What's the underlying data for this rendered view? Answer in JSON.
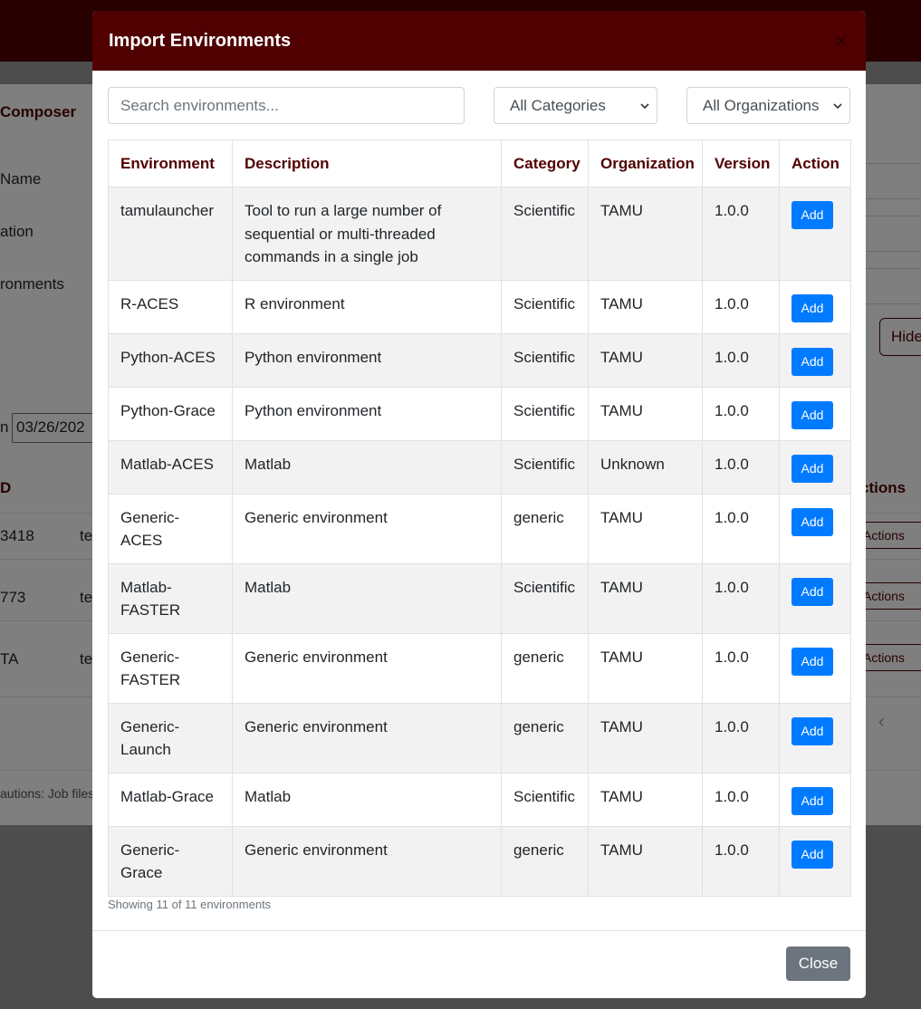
{
  "background": {
    "title": "Composer",
    "labels": [
      "Name",
      "ation",
      "ronments"
    ],
    "date_value": "03/26/202",
    "date_label": "n",
    "table_header_left": "D",
    "table_header_right": "ctions",
    "rows": [
      {
        "id": "3418",
        "name": "te",
        "actions": "Actions"
      },
      {
        "id": "773",
        "name": "te",
        "actions": "Actions"
      },
      {
        "id": "TA",
        "name": "te",
        "actions": "Actions"
      }
    ],
    "hide_button": "Hide",
    "footnote": "autions: Job files",
    "chevron": "‹"
  },
  "modal": {
    "title": "Import Environments",
    "close_x": "×",
    "search": {
      "placeholder": "Search environments...",
      "value": ""
    },
    "category_filter": {
      "selected": "All Categories"
    },
    "organization_filter": {
      "selected": "All Organizations"
    },
    "columns": [
      "Environment",
      "Description",
      "Category",
      "Organization",
      "Version",
      "Action"
    ],
    "rows": [
      {
        "environment": "tamulauncher",
        "description": "Tool to run a large number of sequential or multi-threaded commands in a single job",
        "category": "Scientific",
        "organization": "TAMU",
        "version": "1.0.0",
        "action": "Add"
      },
      {
        "environment": "R-ACES",
        "description": "R environment",
        "category": "Scientific",
        "organization": "TAMU",
        "version": "1.0.0",
        "action": "Add"
      },
      {
        "environment": "Python-ACES",
        "description": "Python environment",
        "category": "Scientific",
        "organization": "TAMU",
        "version": "1.0.0",
        "action": "Add"
      },
      {
        "environment": "Python-Grace",
        "description": "Python environment",
        "category": "Scientific",
        "organization": "TAMU",
        "version": "1.0.0",
        "action": "Add"
      },
      {
        "environment": "Matlab-ACES",
        "description": "Matlab",
        "category": "Scientific",
        "organization": "Unknown",
        "version": "1.0.0",
        "action": "Add"
      },
      {
        "environment": "Generic-ACES",
        "description": "Generic environment",
        "category": "generic",
        "organization": "TAMU",
        "version": "1.0.0",
        "action": "Add"
      },
      {
        "environment": "Matlab-FASTER",
        "description": "Matlab",
        "category": "Scientific",
        "organization": "TAMU",
        "version": "1.0.0",
        "action": "Add"
      },
      {
        "environment": "Generic-FASTER",
        "description": "Generic environment",
        "category": "generic",
        "organization": "TAMU",
        "version": "1.0.0",
        "action": "Add"
      },
      {
        "environment": "Generic-Launch",
        "description": "Generic environment",
        "category": "generic",
        "organization": "TAMU",
        "version": "1.0.0",
        "action": "Add"
      },
      {
        "environment": "Matlab-Grace",
        "description": "Matlab",
        "category": "Scientific",
        "organization": "TAMU",
        "version": "1.0.0",
        "action": "Add"
      },
      {
        "environment": "Generic-Grace",
        "description": "Generic environment",
        "category": "generic",
        "organization": "TAMU",
        "version": "1.0.0",
        "action": "Add"
      }
    ],
    "showing_text": "Showing 11 of 11 environments",
    "close_button": "Close"
  },
  "colors": {
    "brand": "#500000",
    "primary_button": "#007bff",
    "secondary_button": "#6c757d"
  },
  "icons": {
    "modal_close": "close-icon",
    "select_caret": "chevron-down-icon"
  }
}
